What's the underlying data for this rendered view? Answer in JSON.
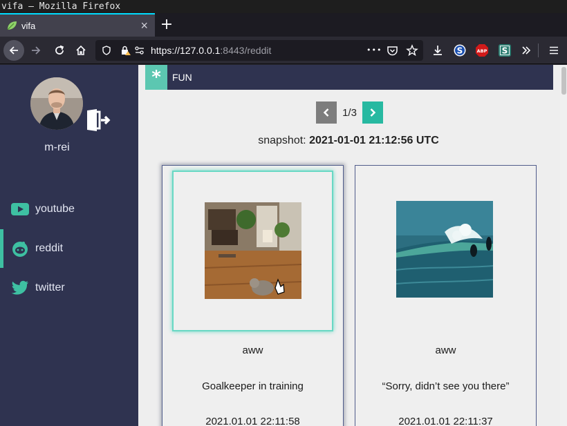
{
  "window": {
    "title": "vifa — Mozilla Firefox"
  },
  "tab": {
    "title": "vifa",
    "close": "×",
    "new_tab": "+"
  },
  "urlbar": {
    "host": "https://127.0.0.1",
    "rest": ":8443/reddit",
    "page_actions": "•••"
  },
  "user": {
    "name": "m-rei"
  },
  "nav": [
    {
      "label": "youtube",
      "active": false
    },
    {
      "label": "reddit",
      "active": true
    },
    {
      "label": "twitter",
      "active": false
    }
  ],
  "category": {
    "icon": "*",
    "label": "FUN"
  },
  "pager": {
    "info": "1/3"
  },
  "snapshot": {
    "label": "snapshot:",
    "value": "2021-01-01 21:12:56 UTC"
  },
  "posts": [
    {
      "subreddit": "aww",
      "title": "Goalkeeper in training",
      "date": "2021.01.01 22:11:58"
    },
    {
      "subreddit": "aww",
      "title": "“Sorry, didn’t see you there”",
      "date": "2021.01.01 22:11:37"
    }
  ],
  "colors": {
    "sidebar": "#2f3350",
    "accent": "#3ec0a2",
    "content_bg": "#eeeeee",
    "youtube_icon": "#3ec0a2"
  }
}
